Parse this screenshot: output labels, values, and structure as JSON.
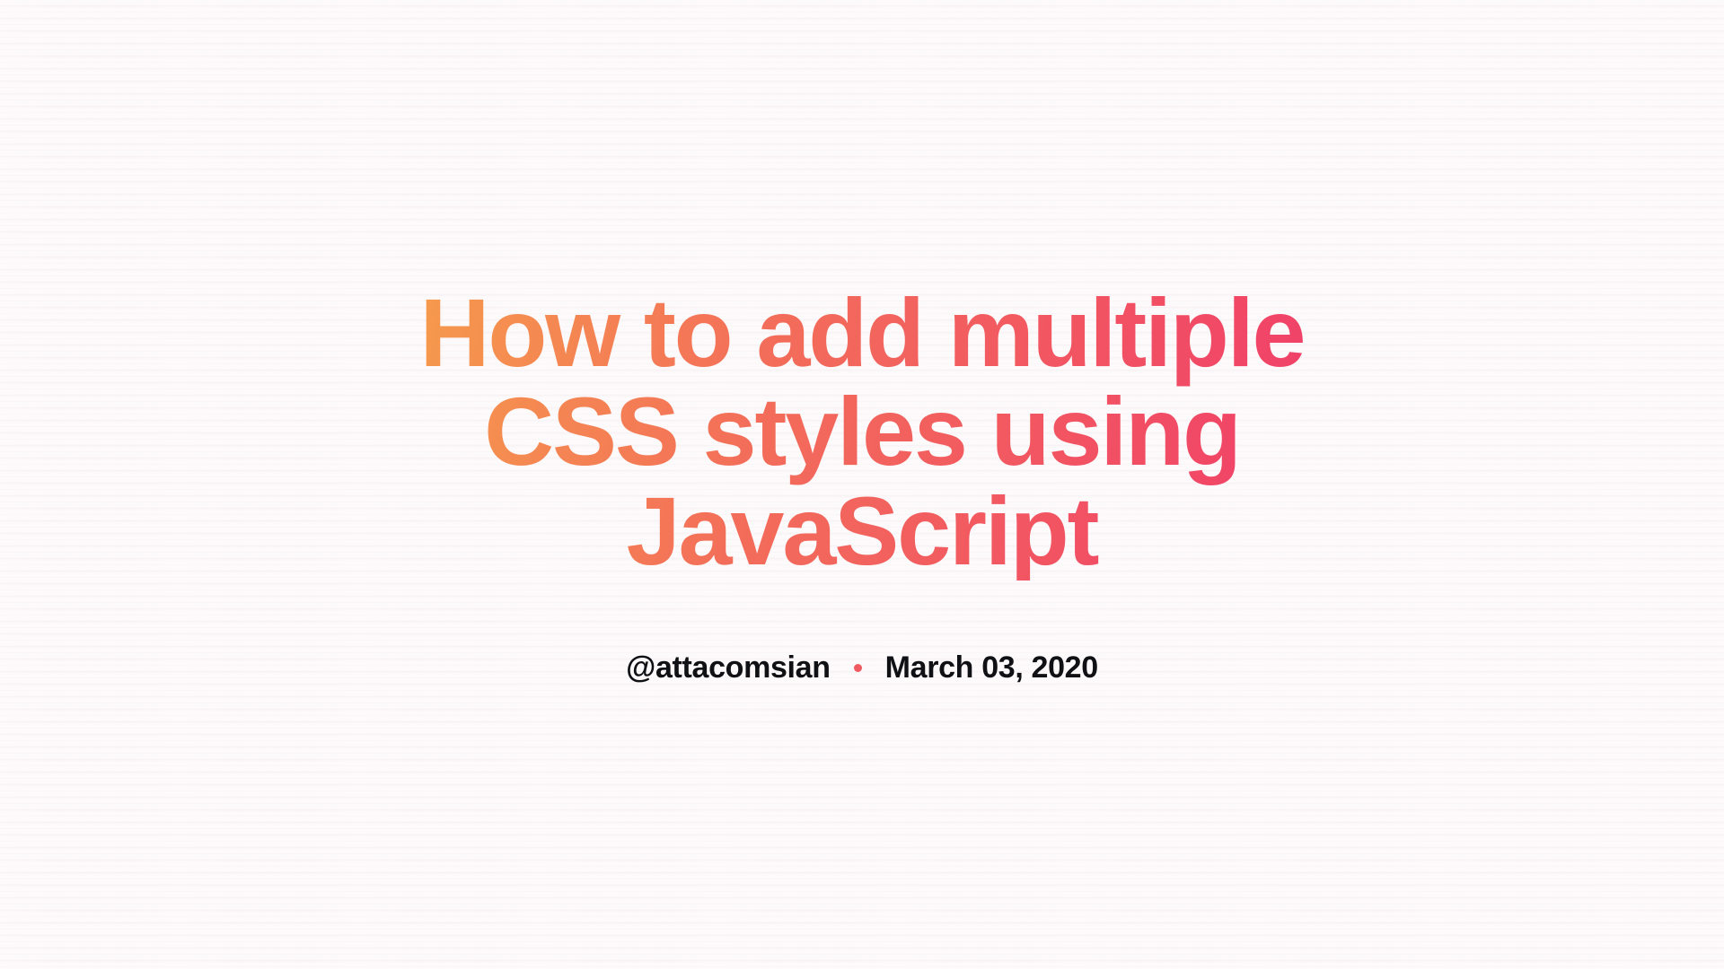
{
  "title": "How to add multiple CSS styles using JavaScript",
  "author_handle": "@attacomsian",
  "date": "March 03, 2020",
  "colors": {
    "gradient_start": "#f6a14a",
    "gradient_mid": "#f36d5a",
    "gradient_end": "#f03a6b",
    "text_dark": "#101114",
    "dot": "#f25a62",
    "bg": "#fdfafb"
  }
}
